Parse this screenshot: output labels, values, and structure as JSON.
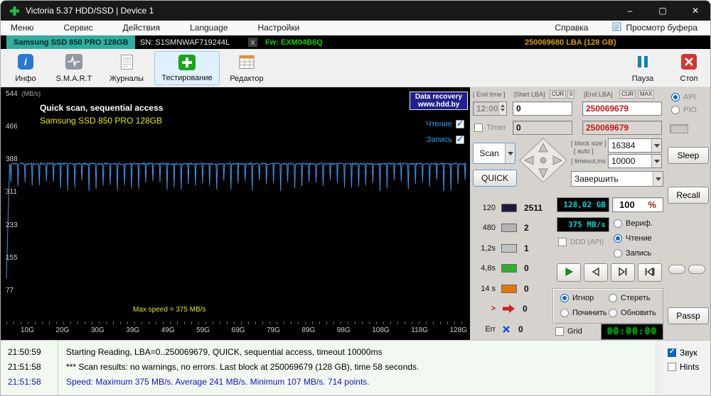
{
  "titlebar": {
    "title": "Victoria 5.37 HDD/SSD | Device 1",
    "minimize_glyph": "–",
    "maximize_glyph": "▢",
    "close_glyph": "✕"
  },
  "menubar": {
    "items": [
      "Меню",
      "Сервис",
      "Действия",
      "Language",
      "Настройки"
    ],
    "help": "Справка",
    "buffer_view": "Просмотр буфера"
  },
  "devicebar": {
    "model": "Samsung SSD 850 PRO 128GB",
    "serial": "SN: S1SMNWAF719244L",
    "close_glyph": "x",
    "firmware": "Fw: EXM04B6Q",
    "capacity": "250069680 LBA (128 GB)"
  },
  "toolbar": {
    "buttons": [
      {
        "label": "Инфо"
      },
      {
        "label": "S.M.A.R.T"
      },
      {
        "label": "Журналы"
      },
      {
        "label": "Тестирование"
      },
      {
        "label": "Редактор"
      }
    ],
    "pause": "Пауза",
    "stop": "Стоп"
  },
  "graph": {
    "title": "Quick scan, sequential access",
    "subtitle": "Samsung SSD 850 PRO 128GB",
    "watermark1": "Data recovery",
    "watermark2": "www.hdd.by",
    "legend": [
      {
        "label": "Чтение",
        "checked": true
      },
      {
        "label": "Запись",
        "checked": true
      }
    ],
    "max_note": "Max speed = 375 MB/s",
    "y_unit": "(MB/s)",
    "y_ticks": [
      "544",
      "466",
      "388",
      "311",
      "233",
      "155",
      "77"
    ],
    "x_ticks": [
      "10G",
      "20G",
      "30G",
      "39G",
      "49G",
      "59G",
      "69G",
      "79G",
      "89G",
      "98G",
      "108G",
      "118G",
      "128G"
    ],
    "curve": {
      "points": 714,
      "y_max": 544,
      "base": 377,
      "start": 107,
      "dip_low": 312,
      "dip_high": 340,
      "dip_every": 11,
      "color": "#3f97e8"
    }
  },
  "panel": {
    "end_time_label": "[ End time ]",
    "start_lba_label": "[Start LBA]",
    "cur_label": "CUR",
    "zero_label": "0",
    "end_lba_label": "[End LBA]",
    "max_label": "MAX",
    "end_time_value": "12:00",
    "start_lba_value": "0",
    "end_lba_value": "250069679",
    "timer_label": "Timer",
    "timer_checked": false,
    "timer_start": "0",
    "timer_end": "250069679",
    "scan_button": "Scan",
    "block_size_label": "[ block size ]",
    "auto_label": "[ auto ]",
    "block_size_value": "16384",
    "timeout_label": "[ timeout,ms ]",
    "timeout_value": "10000",
    "quick_button": "QUICK",
    "action_select": "Завершить",
    "stats": [
      {
        "label": "120",
        "count": "2511",
        "block": "#1c1c38"
      },
      {
        "label": "480",
        "count": "2",
        "block": "#b2b2b2"
      },
      {
        "label": "1,2s",
        "count": "1",
        "block": "#c2c2c2"
      },
      {
        "label": "4,8s",
        "count": "0",
        "block": "#2eb02e"
      },
      {
        "label": "14 s",
        "count": "0",
        "block": "#e07800"
      },
      {
        "label": ">",
        "count": "0",
        "block": "arrow"
      },
      {
        "label": "Err",
        "count": "0",
        "block": "cross"
      }
    ],
    "lcd_size": "128,02 GB",
    "lcd_percent": "100",
    "percent_sign": "%",
    "lcd_speed": "375 MB/s",
    "mode_radios": [
      {
        "label": "Вериф.",
        "selected": false
      },
      {
        "label": "Чтение",
        "selected": true
      },
      {
        "label": "Запись",
        "selected": false
      }
    ],
    "ddd_label": "DDD (API)",
    "ddd_checked": false,
    "action_radios": [
      {
        "label": "Игнор",
        "selected": true
      },
      {
        "label": "Стереть",
        "selected": false
      },
      {
        "label": "Починить",
        "selected": false
      },
      {
        "label": "Обновить",
        "selected": false
      }
    ],
    "grid_label": "Grid",
    "grid_checked": false,
    "lcd_timer": "00:00:00"
  },
  "sidebar": {
    "api_label": "API",
    "api_selected": true,
    "pio_label": "PIO",
    "pio_selected": false,
    "sleep": "Sleep",
    "recall": "Recall",
    "passp": "Passp"
  },
  "log": {
    "rows": [
      {
        "time": "21:50:59",
        "text": "Starting Reading, LBA=0..250069679, QUICK, sequential access, timeout 10000ms",
        "color": "#000000"
      },
      {
        "time": "21:51:58",
        "text": "*** Scan results: no warnings, no errors. Last block at 250069679 (128 GB), time 58 seconds.",
        "color": "#000000"
      },
      {
        "time": "21:51:58",
        "text": "Speed: Maximum 375 MB/s. Average 241 MB/s. Minimum 107 MB/s. 714 points.",
        "color": "#1414cc"
      }
    ],
    "sound_label": "Звук",
    "sound_checked": true,
    "hints_label": "Hints",
    "hints_checked": false
  }
}
